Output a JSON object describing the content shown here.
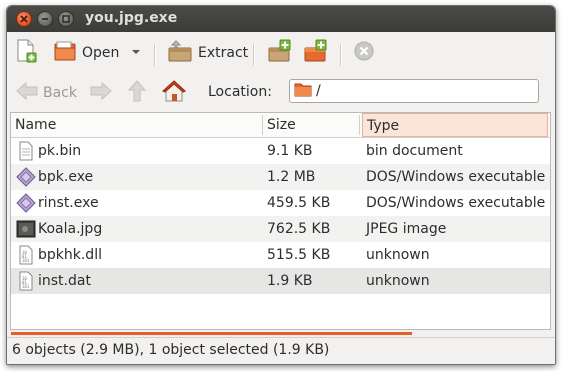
{
  "window": {
    "title": "you.jpg.exe"
  },
  "toolbar": {
    "open_label": "Open",
    "extract_label": "Extract"
  },
  "nav": {
    "back_label": "Back",
    "location_label": "Location:",
    "location_value": "/"
  },
  "table": {
    "columns": [
      "Name",
      "Size",
      "Type"
    ],
    "rows": [
      {
        "name": "pk.bin",
        "size": "9.1 KB",
        "type": "bin document",
        "icon": "document-icon"
      },
      {
        "name": "bpk.exe",
        "size": "1.2 MB",
        "type": "DOS/Windows executable",
        "icon": "executable-icon"
      },
      {
        "name": "rinst.exe",
        "size": "459.5 KB",
        "type": "DOS/Windows executable",
        "icon": "executable-icon"
      },
      {
        "name": "Koala.jpg",
        "size": "762.5 KB",
        "type": "JPEG image",
        "icon": "image-icon"
      },
      {
        "name": "bpkhk.dll",
        "size": "515.5 KB",
        "type": "unknown",
        "icon": "binary-file-icon"
      },
      {
        "name": "inst.dat",
        "size": "1.9 KB",
        "type": "unknown",
        "icon": "binary-file-icon"
      }
    ]
  },
  "status": {
    "text": "6 objects (2.9 MB), 1 object selected (1.9 KB)"
  },
  "colors": {
    "accent": "#e35f2a",
    "titlebar": "#3c3b37"
  }
}
